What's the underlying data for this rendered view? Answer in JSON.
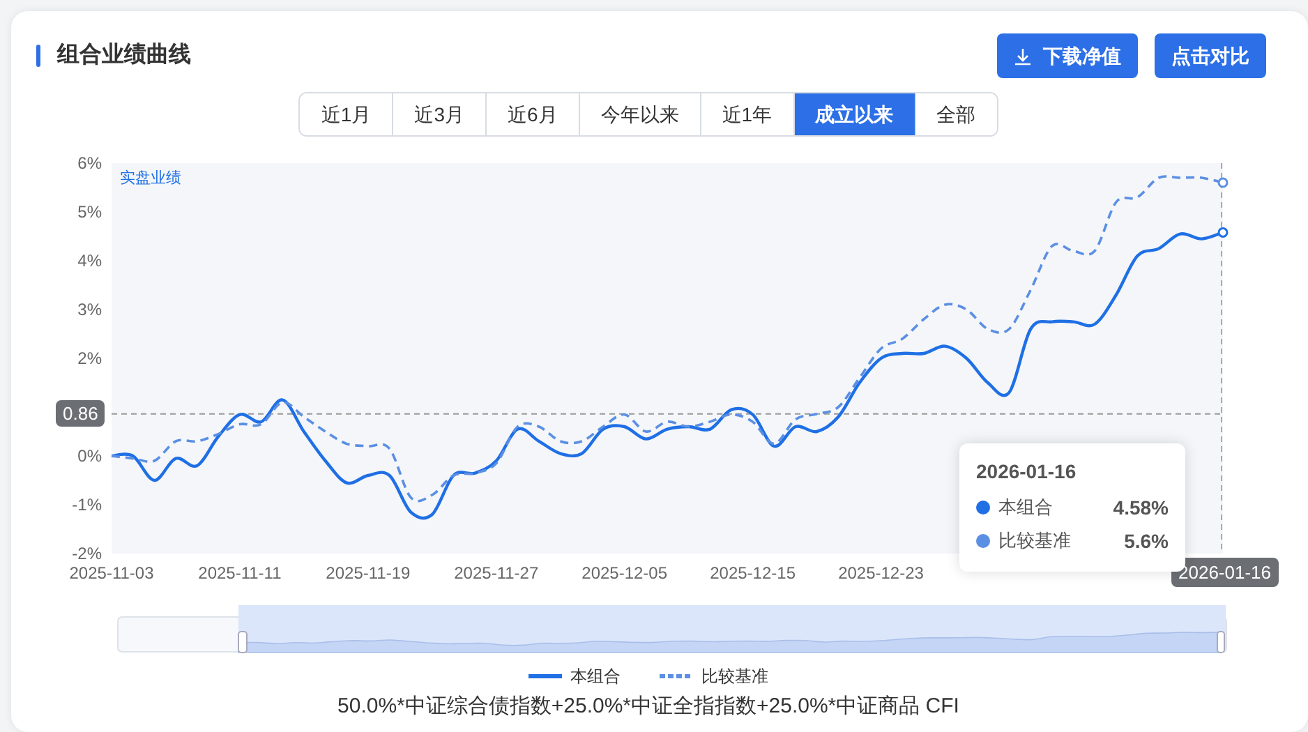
{
  "title": "组合业绩曲线",
  "buttons": [
    {
      "label": "下载净值",
      "kind": "download"
    },
    {
      "label": "点击对比",
      "kind": "plain"
    }
  ],
  "tabs": [
    {
      "label": "近1月",
      "selected": false
    },
    {
      "label": "近3月",
      "selected": false
    },
    {
      "label": "近6月",
      "selected": false
    },
    {
      "label": "今年以来",
      "selected": false
    },
    {
      "label": "近1年",
      "selected": false
    },
    {
      "label": "成立以来",
      "selected": true
    },
    {
      "label": "全部",
      "selected": false
    }
  ],
  "chart": {
    "note": "实盘业绩",
    "chart_data": {
      "type": "line",
      "categories": [
        "2025-11-03",
        null,
        null,
        null,
        null,
        null,
        "2025-11-11",
        null,
        null,
        null,
        null,
        null,
        "2025-11-19",
        null,
        null,
        null,
        null,
        null,
        "2025-11-27",
        null,
        null,
        null,
        null,
        null,
        "2025-12-05",
        null,
        null,
        null,
        null,
        null,
        "2025-12-15",
        null,
        null,
        null,
        null,
        null,
        "2025-12-23",
        null,
        null,
        null,
        null,
        null,
        null,
        null,
        null,
        null,
        null,
        null,
        null,
        null,
        null,
        null,
        "2026-01-16"
      ],
      "series": [
        {
          "name": "本组合",
          "color": "#1f6fe5",
          "line_style": "solid",
          "values": [
            0,
            0,
            -0.5,
            -0.05,
            -0.2,
            0.4,
            0.85,
            0.7,
            1.15,
            0.5,
            -0.1,
            -0.55,
            -0.4,
            -0.4,
            -1.15,
            -1.2,
            -0.4,
            -0.35,
            -0.1,
            0.55,
            0.3,
            0.05,
            0.05,
            0.55,
            0.6,
            0.35,
            0.55,
            0.6,
            0.55,
            0.95,
            0.85,
            0.2,
            0.6,
            0.5,
            0.8,
            1.5,
            2.0,
            2.1,
            2.1,
            2.25,
            2.0,
            1.5,
            1.3,
            2.6,
            2.75,
            2.75,
            2.7,
            3.3,
            4.1,
            4.25,
            4.55,
            4.45,
            4.58
          ]
        },
        {
          "name": "比较基准",
          "color": "#5b8fe3",
          "line_style": "dashed",
          "values": [
            0,
            -0.05,
            -0.1,
            0.3,
            0.3,
            0.45,
            0.65,
            0.65,
            1.1,
            0.8,
            0.5,
            0.25,
            0.2,
            0.15,
            -0.85,
            -0.8,
            -0.4,
            -0.35,
            -0.15,
            0.6,
            0.6,
            0.3,
            0.3,
            0.6,
            0.85,
            0.5,
            0.7,
            0.6,
            0.7,
            0.85,
            0.7,
            0.25,
            0.75,
            0.86,
            1.0,
            1.6,
            2.2,
            2.4,
            2.8,
            3.1,
            3.0,
            2.6,
            2.6,
            3.4,
            4.3,
            4.2,
            4.2,
            5.2,
            5.3,
            5.7,
            5.7,
            5.7,
            5.6
          ]
        }
      ],
      "ylim": [
        -2,
        6
      ],
      "legend": "bottom",
      "ref_lines": [
        {
          "axis": "y",
          "value": 0.86,
          "label": "0.86"
        },
        {
          "axis": "x",
          "value": "2026-01-16"
        }
      ],
      "yticks": [
        {
          "value": -2,
          "label": "-2%"
        },
        {
          "value": -1,
          "label": "-1%"
        },
        {
          "value": 0,
          "label": "0%"
        },
        {
          "value": 2,
          "label": "2%"
        },
        {
          "value": 3,
          "label": "3%"
        },
        {
          "value": 4,
          "label": "4%"
        },
        {
          "value": 5,
          "label": "5%"
        },
        {
          "value": 6,
          "label": "6%"
        }
      ]
    },
    "tooltip": {
      "date": "2026-01-16",
      "rows": [
        {
          "name": "本组合",
          "value": "4.58%",
          "color": "#1f6fe5"
        },
        {
          "name": "比较基准",
          "value": "5.6%",
          "color": "#5b8fe3"
        }
      ]
    }
  },
  "slider": {
    "level": 0.89
  },
  "benchmark": "50.0%*中证综合债指数+25.0%*中证全指指数+25.0%*中证商品 CFI"
}
